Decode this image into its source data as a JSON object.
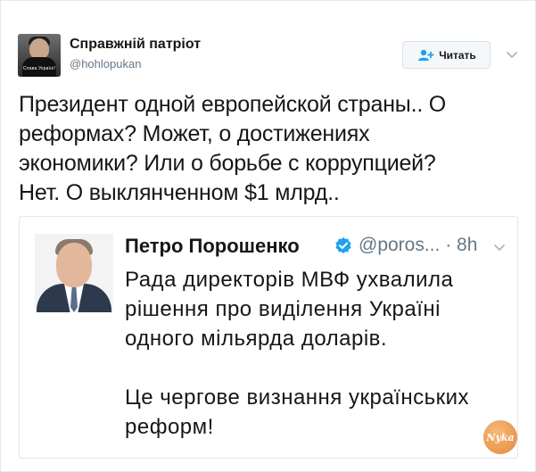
{
  "tweet": {
    "author_name": "Справжній патріот",
    "author_handle": "@hohlopukan",
    "avatar_caption": "Слава Україні!",
    "follow_label": "Читать",
    "text_lines": [
      "Президент одной европейской страны.. О",
      "реформах? Может, о достижениях",
      "экономики? Или о борьбе с коррупцией?",
      "Нет. О выклянченном $1 млрд.."
    ]
  },
  "quoted_tweet": {
    "author_name": "Петро Порошенко",
    "handle_truncated": "@poros...",
    "separator": "·",
    "time": "8h",
    "text_lines": [
      "Рада директорів МВФ ухвалила",
      "рішення про виділення Україні",
      "одного мільярда доларів.",
      "",
      "Це чергове визнання українських",
      "реформ!"
    ]
  },
  "watermark": {
    "text": "Nyka"
  },
  "icons": {
    "follow": "add-user-icon",
    "menu": "chevron-down-icon",
    "verified": "verified-badge-icon"
  },
  "colors": {
    "accent": "#1da1f2",
    "text": "#14171a",
    "muted": "#657786",
    "border": "#e1e8ed"
  }
}
